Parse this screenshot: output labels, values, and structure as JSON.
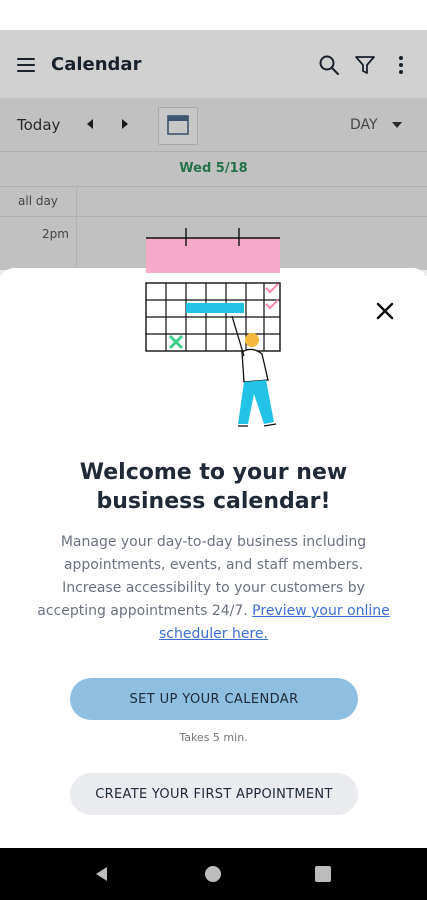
{
  "app": {
    "title": "Calendar",
    "menu_icon": "menu-icon",
    "search_icon": "search-icon",
    "filter_icon": "filter-icon",
    "more_icon": "more-vert-icon"
  },
  "toolbar": {
    "today_label": "Today",
    "prev_icon": "chevron-left-icon",
    "next_icon": "chevron-right-icon",
    "calendar_icon": "calendar-icon",
    "view_label": "DAY",
    "view_icon": "dropdown-arrow-icon"
  },
  "calendar": {
    "date_label": "Wed 5/18",
    "all_day_label": "all day",
    "time_label": "2pm"
  },
  "sheet": {
    "close_icon": "close-icon",
    "illustration": "calendar-illustration",
    "heading_line1": "Welcome to your new",
    "heading_line2": "business calendar!",
    "description": "Manage your day-to-day business including appointments, events, and staff members. Increase accessibility to your customers by accepting appointments 24/7.",
    "link_text": "Preview your online scheduler here.",
    "primary_button": "SET UP YOUR CALENDAR",
    "primary_hint": "Takes 5 min.",
    "secondary_button": "CREATE YOUR FIRST APPOINTMENT"
  },
  "navbar": {
    "back_icon": "back-icon",
    "home_icon": "home-icon",
    "recents_icon": "recents-icon"
  },
  "colors": {
    "accent_green": "#2e8b57",
    "primary_button": "#8fbfe0",
    "secondary_button": "#e9ebef",
    "link": "#3b6fd6"
  }
}
